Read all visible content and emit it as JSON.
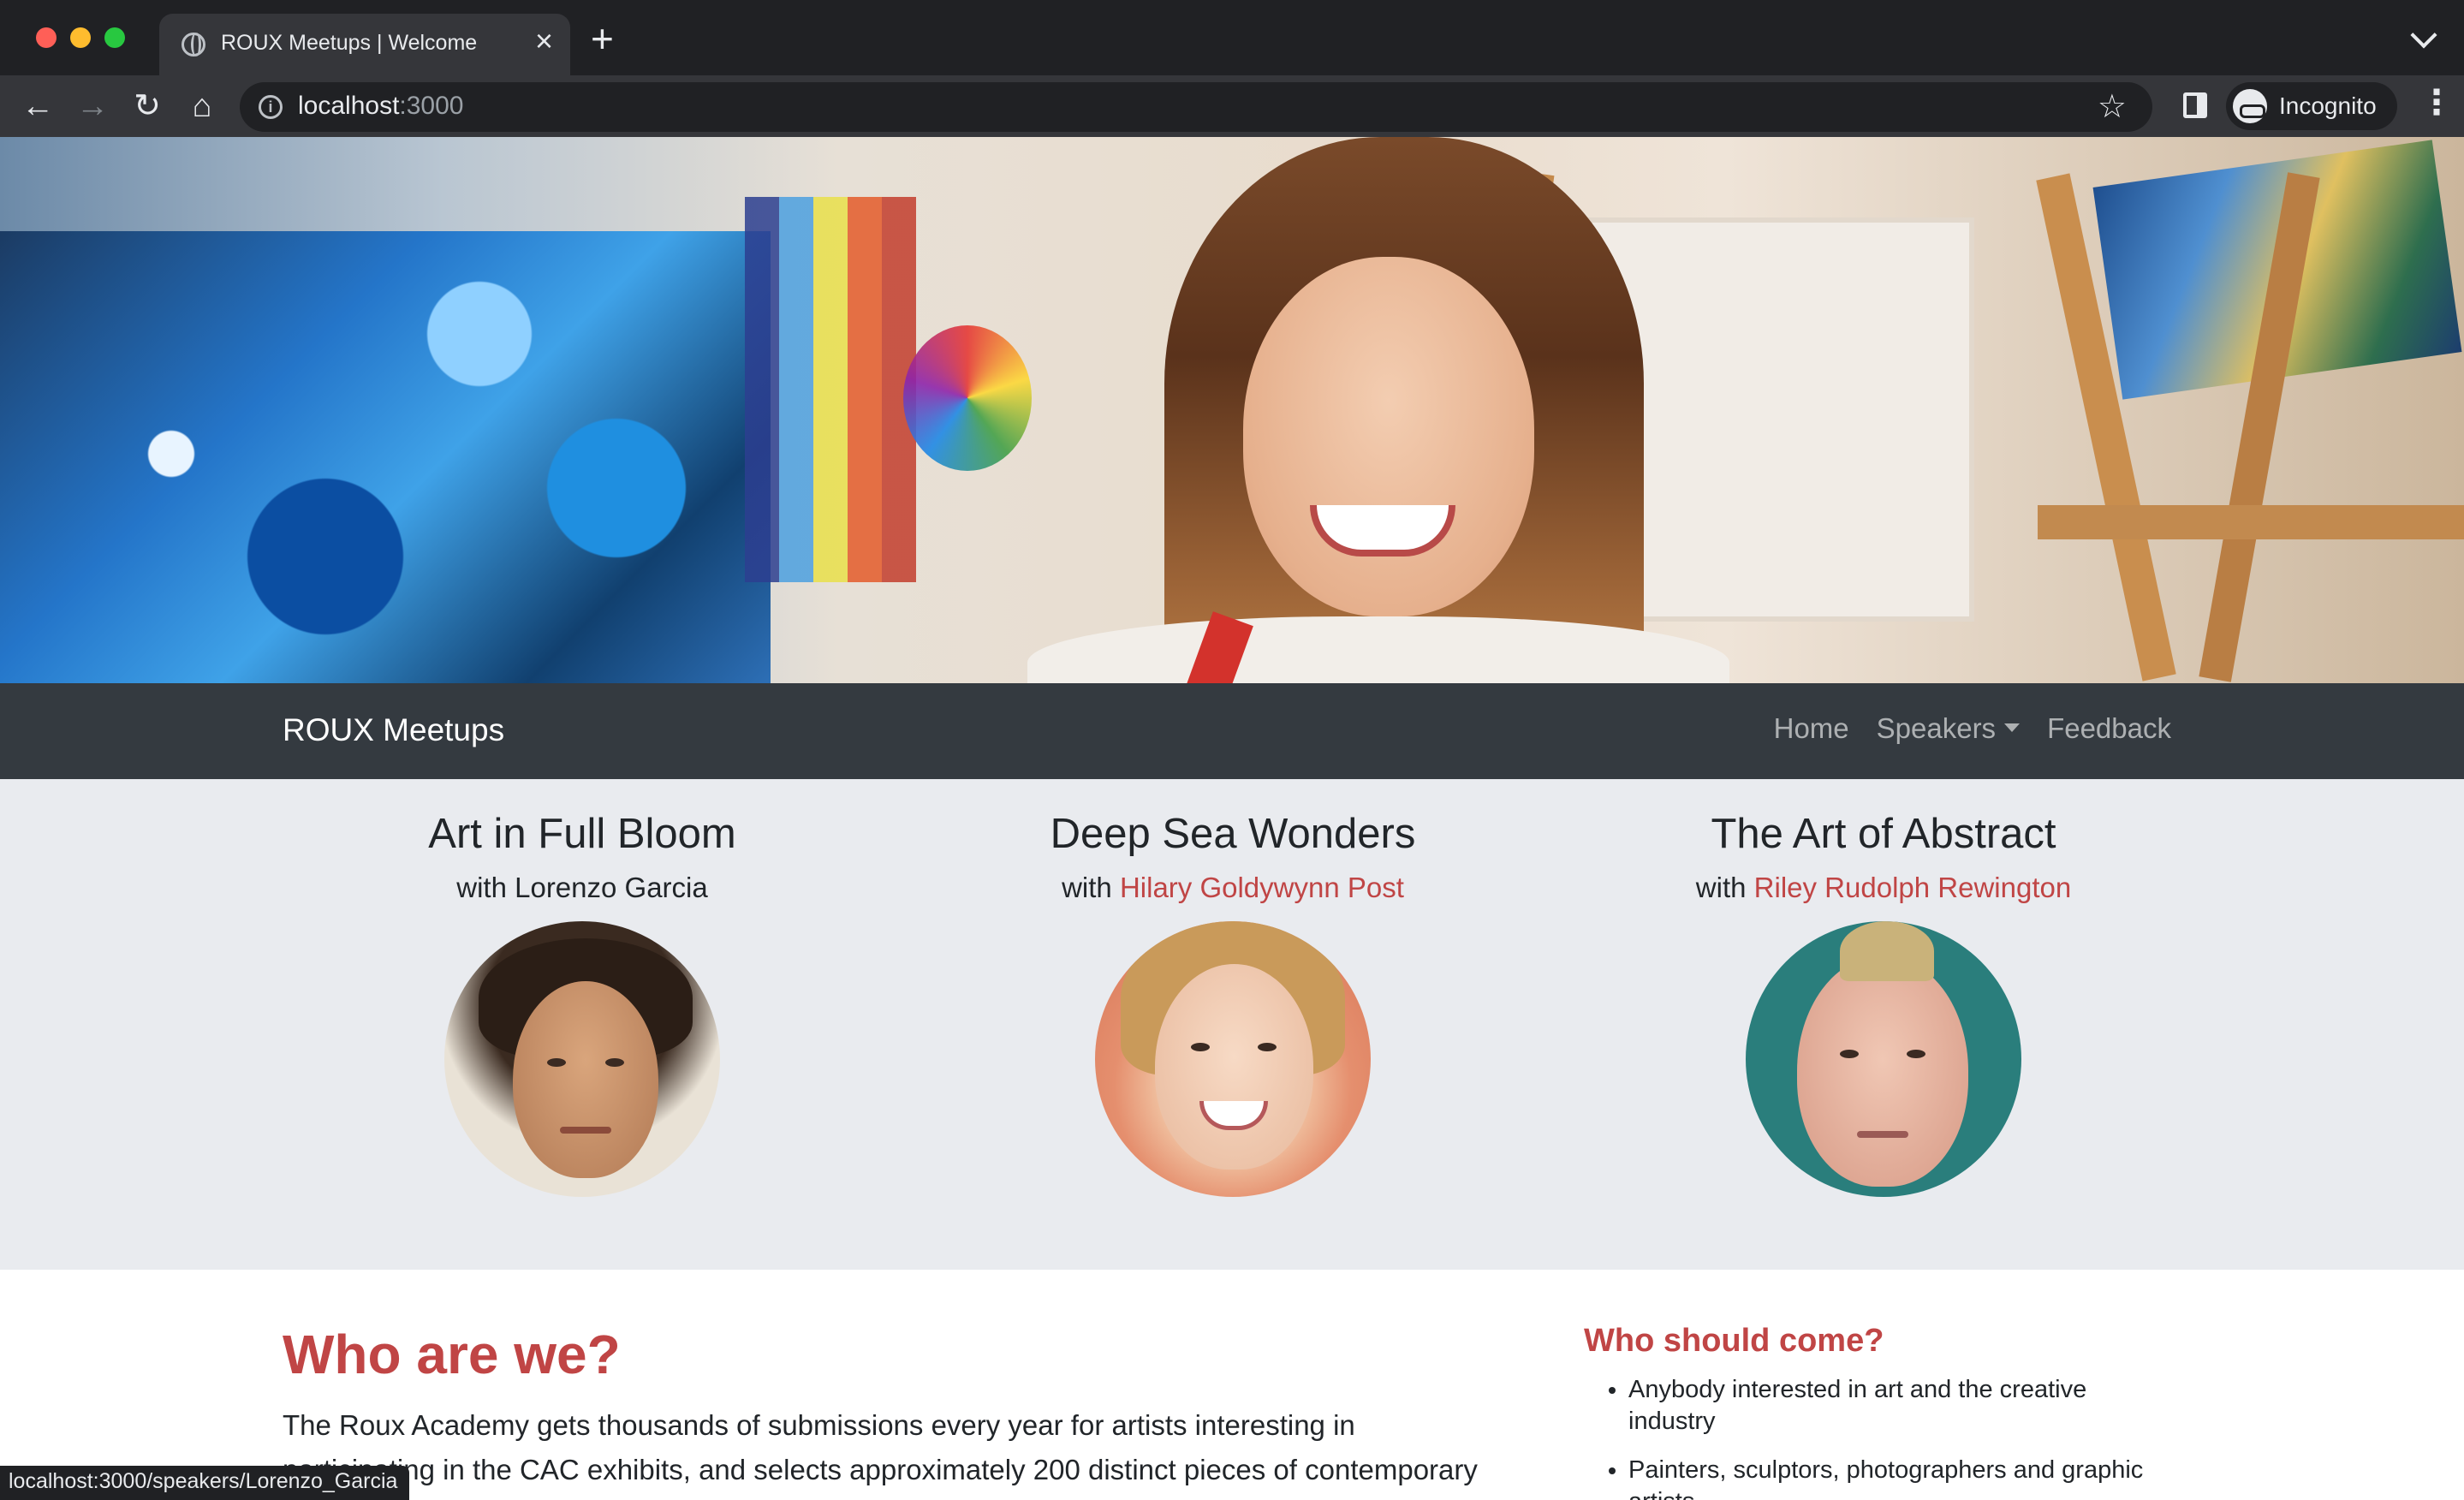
{
  "browser": {
    "tab_title": "ROUX Meetups | Welcome",
    "tab_close": "×",
    "new_tab": "+",
    "url_host": "localhost",
    "url_port": ":3000",
    "profile_label": "Incognito",
    "status_url": "localhost:3000/speakers/Lorenzo_Garcia",
    "icons": {
      "back": "back-arrow-icon",
      "forward": "forward-arrow-icon",
      "reload": "reload-icon",
      "home": "home-icon",
      "bookmark": "star-icon"
    }
  },
  "navbar": {
    "brand": "ROUX Meetups",
    "links": [
      {
        "label": "Home"
      },
      {
        "label": "Speakers"
      },
      {
        "label": "Feedback"
      }
    ]
  },
  "speakers": [
    {
      "title": "Art in Full Bloom",
      "with": "with",
      "name": "Lorenzo Garcia",
      "is_link": false
    },
    {
      "title": "Deep Sea Wonders",
      "with": "with",
      "name": "Hilary Goldywynn Post",
      "is_link": true
    },
    {
      "title": "The Art of Abstract",
      "with": "with",
      "name": "Riley Rudolph Rewington",
      "is_link": true
    }
  ],
  "about": {
    "title": "Who are we?",
    "text": "The Roux Academy gets thousands of submissions every year for artists interesting in participating in the CAC exhibits, and selects approximately 200 distinct pieces of contemporary art for display in their"
  },
  "audience": {
    "title": "Who should come?",
    "items": [
      "Anybody interested in art and the creative industry",
      "Painters, sculptors, photographers and graphic artists"
    ]
  },
  "colors": {
    "accent": "#c04545",
    "navbar_bg": "#343a40",
    "speakers_bg": "#e9ebef"
  }
}
